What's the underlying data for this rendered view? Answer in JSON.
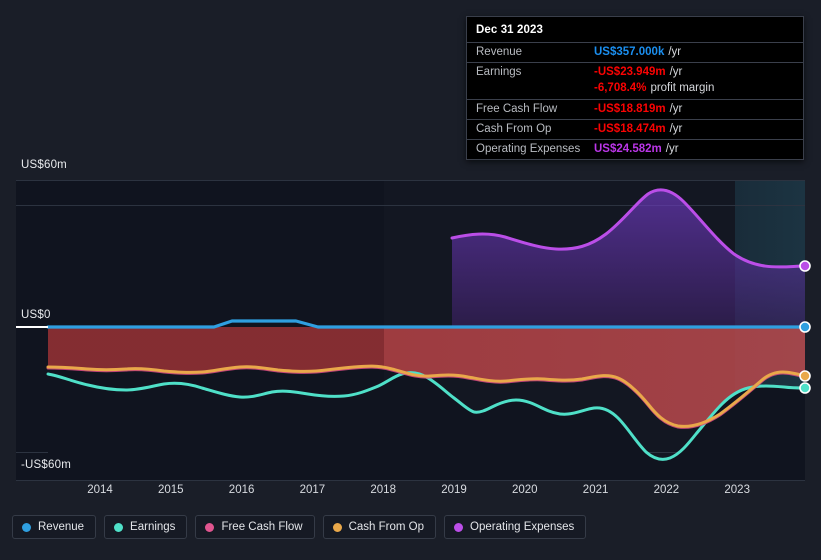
{
  "tooltip": {
    "title": "Dec 31 2023",
    "rows": [
      {
        "label": "Revenue",
        "value": "US$357.000k",
        "unit": "/yr",
        "color": "#1b8ff0"
      },
      {
        "label": "Earnings",
        "value": "-US$23.949m",
        "unit": "/yr",
        "color": "#fb0303"
      },
      {
        "label": "",
        "value": "-6,708.4%",
        "unit": "profit margin",
        "color": "#fb0303",
        "sub": true
      },
      {
        "label": "Free Cash Flow",
        "value": "-US$18.819m",
        "unit": "/yr",
        "color": "#fb0303"
      },
      {
        "label": "Cash From Op",
        "value": "-US$18.474m",
        "unit": "/yr",
        "color": "#fb0303"
      },
      {
        "label": "Operating Expenses",
        "value": "US$24.582m",
        "unit": "/yr",
        "color": "#bb36e8"
      }
    ]
  },
  "axis": {
    "y_labels": [
      "US$60m",
      "US$0",
      "-US$60m"
    ],
    "y_top": "US$60m",
    "y_zero": "US$0",
    "y_bottom": "-US$60m",
    "x_labels": [
      "2014",
      "2015",
      "2016",
      "2017",
      "2018",
      "2019",
      "2020",
      "2021",
      "2022",
      "2023"
    ]
  },
  "legend": {
    "items": [
      {
        "label": "Revenue",
        "color": "#2f9fe0"
      },
      {
        "label": "Earnings",
        "color": "#4fe0c8"
      },
      {
        "label": "Free Cash Flow",
        "color": "#e0558f"
      },
      {
        "label": "Cash From Op",
        "color": "#e9a84a"
      },
      {
        "label": "Operating Expenses",
        "color": "#bb4ee8"
      }
    ]
  },
  "chart_data": {
    "type": "area",
    "title": "",
    "xlabel": "",
    "ylabel": "US$",
    "ylim": [
      -60,
      60
    ],
    "yticks": [
      60,
      0,
      -60
    ],
    "x": [
      2013.4,
      2014,
      2015,
      2016,
      2017,
      2018,
      2019,
      2020,
      2021,
      2022,
      2023,
      2023.9
    ],
    "grid": true,
    "legend_position": "bottom",
    "forecast_start": 2023.1,
    "series": [
      {
        "name": "Revenue",
        "color": "#2f9fe0",
        "unit": "US$m",
        "values": [
          0.0,
          0.0,
          0.0,
          1.9,
          1.9,
          0.0,
          0.0,
          0.0,
          0.0,
          0.0,
          0.357,
          0.357
        ]
      },
      {
        "name": "Earnings",
        "color": "#4fe0c8",
        "unit": "US$m",
        "values": [
          -11.5,
          -15.0,
          -16.5,
          -14.5,
          -16.0,
          -13.0,
          -22.5,
          -19.0,
          -20.0,
          -41.0,
          -26.0,
          -23.949
        ]
      },
      {
        "name": "Free Cash Flow",
        "color": "#e0558f",
        "unit": "US$m",
        "values": [
          -8.5,
          -12.0,
          -13.5,
          -12.0,
          -14.5,
          -16.5,
          -16.5,
          -15.5,
          -18.0,
          -29.0,
          -22.0,
          -18.819
        ]
      },
      {
        "name": "Cash From Op",
        "color": "#e9a84a",
        "unit": "US$m",
        "values": [
          -8.2,
          -11.8,
          -13.2,
          -11.8,
          -14.2,
          -16.2,
          -16.2,
          -15.2,
          -17.6,
          -28.6,
          -21.6,
          -18.474
        ]
      },
      {
        "name": "Operating Expenses",
        "color": "#bb4ee8",
        "unit": "US$m",
        "values": [
          null,
          null,
          null,
          null,
          null,
          null,
          35.5,
          31.0,
          36.0,
          47.5,
          30.0,
          24.582
        ]
      }
    ]
  }
}
